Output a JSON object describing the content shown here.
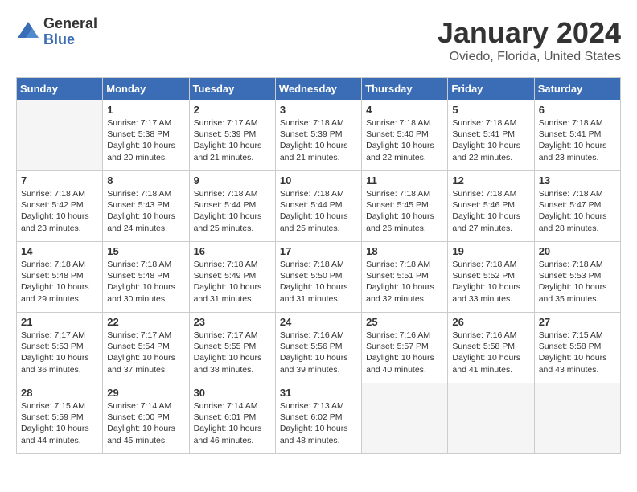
{
  "logo": {
    "general": "General",
    "blue": "Blue"
  },
  "title": "January 2024",
  "location": "Oviedo, Florida, United States",
  "days_of_week": [
    "Sunday",
    "Monday",
    "Tuesday",
    "Wednesday",
    "Thursday",
    "Friday",
    "Saturday"
  ],
  "weeks": [
    [
      {
        "day": "",
        "content": ""
      },
      {
        "day": "1",
        "content": "Sunrise: 7:17 AM\nSunset: 5:38 PM\nDaylight: 10 hours\nand 20 minutes."
      },
      {
        "day": "2",
        "content": "Sunrise: 7:17 AM\nSunset: 5:39 PM\nDaylight: 10 hours\nand 21 minutes."
      },
      {
        "day": "3",
        "content": "Sunrise: 7:18 AM\nSunset: 5:39 PM\nDaylight: 10 hours\nand 21 minutes."
      },
      {
        "day": "4",
        "content": "Sunrise: 7:18 AM\nSunset: 5:40 PM\nDaylight: 10 hours\nand 22 minutes."
      },
      {
        "day": "5",
        "content": "Sunrise: 7:18 AM\nSunset: 5:41 PM\nDaylight: 10 hours\nand 22 minutes."
      },
      {
        "day": "6",
        "content": "Sunrise: 7:18 AM\nSunset: 5:41 PM\nDaylight: 10 hours\nand 23 minutes."
      }
    ],
    [
      {
        "day": "7",
        "content": "Sunrise: 7:18 AM\nSunset: 5:42 PM\nDaylight: 10 hours\nand 23 minutes."
      },
      {
        "day": "8",
        "content": "Sunrise: 7:18 AM\nSunset: 5:43 PM\nDaylight: 10 hours\nand 24 minutes."
      },
      {
        "day": "9",
        "content": "Sunrise: 7:18 AM\nSunset: 5:44 PM\nDaylight: 10 hours\nand 25 minutes."
      },
      {
        "day": "10",
        "content": "Sunrise: 7:18 AM\nSunset: 5:44 PM\nDaylight: 10 hours\nand 25 minutes."
      },
      {
        "day": "11",
        "content": "Sunrise: 7:18 AM\nSunset: 5:45 PM\nDaylight: 10 hours\nand 26 minutes."
      },
      {
        "day": "12",
        "content": "Sunrise: 7:18 AM\nSunset: 5:46 PM\nDaylight: 10 hours\nand 27 minutes."
      },
      {
        "day": "13",
        "content": "Sunrise: 7:18 AM\nSunset: 5:47 PM\nDaylight: 10 hours\nand 28 minutes."
      }
    ],
    [
      {
        "day": "14",
        "content": "Sunrise: 7:18 AM\nSunset: 5:48 PM\nDaylight: 10 hours\nand 29 minutes."
      },
      {
        "day": "15",
        "content": "Sunrise: 7:18 AM\nSunset: 5:48 PM\nDaylight: 10 hours\nand 30 minutes."
      },
      {
        "day": "16",
        "content": "Sunrise: 7:18 AM\nSunset: 5:49 PM\nDaylight: 10 hours\nand 31 minutes."
      },
      {
        "day": "17",
        "content": "Sunrise: 7:18 AM\nSunset: 5:50 PM\nDaylight: 10 hours\nand 31 minutes."
      },
      {
        "day": "18",
        "content": "Sunrise: 7:18 AM\nSunset: 5:51 PM\nDaylight: 10 hours\nand 32 minutes."
      },
      {
        "day": "19",
        "content": "Sunrise: 7:18 AM\nSunset: 5:52 PM\nDaylight: 10 hours\nand 33 minutes."
      },
      {
        "day": "20",
        "content": "Sunrise: 7:18 AM\nSunset: 5:53 PM\nDaylight: 10 hours\nand 35 minutes."
      }
    ],
    [
      {
        "day": "21",
        "content": "Sunrise: 7:17 AM\nSunset: 5:53 PM\nDaylight: 10 hours\nand 36 minutes."
      },
      {
        "day": "22",
        "content": "Sunrise: 7:17 AM\nSunset: 5:54 PM\nDaylight: 10 hours\nand 37 minutes."
      },
      {
        "day": "23",
        "content": "Sunrise: 7:17 AM\nSunset: 5:55 PM\nDaylight: 10 hours\nand 38 minutes."
      },
      {
        "day": "24",
        "content": "Sunrise: 7:16 AM\nSunset: 5:56 PM\nDaylight: 10 hours\nand 39 minutes."
      },
      {
        "day": "25",
        "content": "Sunrise: 7:16 AM\nSunset: 5:57 PM\nDaylight: 10 hours\nand 40 minutes."
      },
      {
        "day": "26",
        "content": "Sunrise: 7:16 AM\nSunset: 5:58 PM\nDaylight: 10 hours\nand 41 minutes."
      },
      {
        "day": "27",
        "content": "Sunrise: 7:15 AM\nSunset: 5:58 PM\nDaylight: 10 hours\nand 43 minutes."
      }
    ],
    [
      {
        "day": "28",
        "content": "Sunrise: 7:15 AM\nSunset: 5:59 PM\nDaylight: 10 hours\nand 44 minutes."
      },
      {
        "day": "29",
        "content": "Sunrise: 7:14 AM\nSunset: 6:00 PM\nDaylight: 10 hours\nand 45 minutes."
      },
      {
        "day": "30",
        "content": "Sunrise: 7:14 AM\nSunset: 6:01 PM\nDaylight: 10 hours\nand 46 minutes."
      },
      {
        "day": "31",
        "content": "Sunrise: 7:13 AM\nSunset: 6:02 PM\nDaylight: 10 hours\nand 48 minutes."
      },
      {
        "day": "",
        "content": ""
      },
      {
        "day": "",
        "content": ""
      },
      {
        "day": "",
        "content": ""
      }
    ]
  ]
}
